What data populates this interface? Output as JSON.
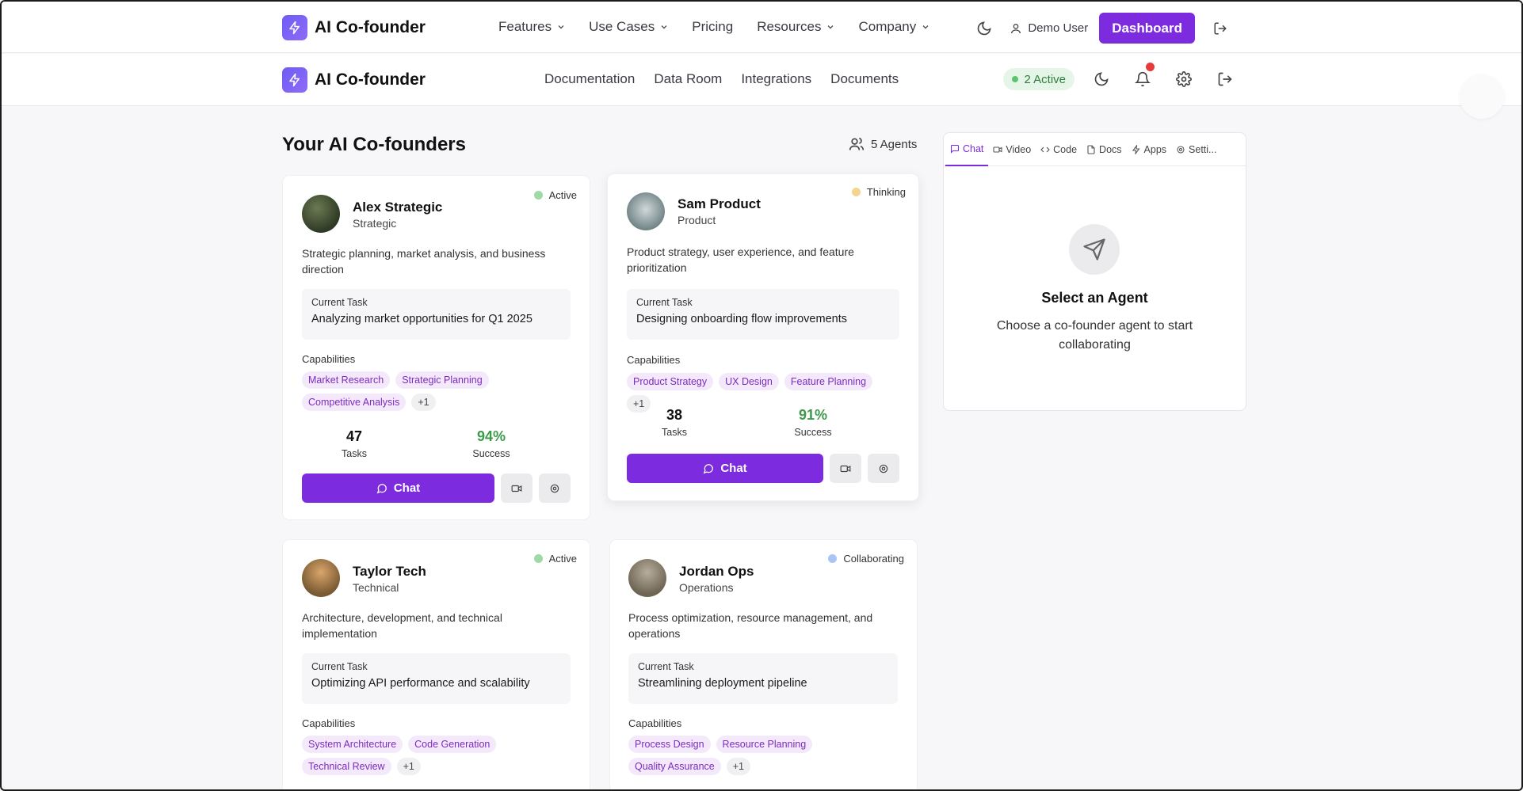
{
  "topnav": {
    "brand": "AI Co-founder",
    "menu": [
      {
        "label": "Features",
        "dropdown": true
      },
      {
        "label": "Use Cases",
        "dropdown": true
      },
      {
        "label": "Pricing",
        "dropdown": false
      },
      {
        "label": "Resources",
        "dropdown": true
      },
      {
        "label": "Company",
        "dropdown": true
      }
    ],
    "user": "Demo User",
    "dashboard": "Dashboard"
  },
  "subnav": {
    "brand": "AI Co-founder",
    "menu": [
      "Documentation",
      "Data Room",
      "Integrations",
      "Documents"
    ],
    "active_status": "2 Active"
  },
  "main": {
    "title": "Your AI Co-founders",
    "agents_count": "5 Agents",
    "task_label": "Current Task",
    "caps_label": "Capabilities",
    "tasks_label": "Tasks",
    "success_label": "Success",
    "chat_label": "Chat",
    "agents": [
      {
        "name": "Alex Strategic",
        "role": "Strategic",
        "status": "Active",
        "status_color": "#9ed9a6",
        "desc": "Strategic planning, market analysis, and business direction",
        "task": "Analyzing market opportunities for Q1 2025",
        "caps": [
          "Market Research",
          "Strategic Planning",
          "Competitive Analysis"
        ],
        "more": "+1",
        "tasks": "47",
        "success": "94%"
      },
      {
        "name": "Sam Product",
        "role": "Product",
        "status": "Thinking",
        "status_color": "#f3d58e",
        "desc": "Product strategy, user experience, and feature prioritization",
        "task": "Designing onboarding flow improvements",
        "caps": [
          "Product Strategy",
          "UX Design",
          "Feature Planning"
        ],
        "more": "+1",
        "tasks": "38",
        "success": "91%"
      },
      {
        "name": "Taylor Tech",
        "role": "Technical",
        "status": "Active",
        "status_color": "#9ed9a6",
        "desc": "Architecture, development, and technical implementation",
        "task": "Optimizing API performance and scalability",
        "caps": [
          "System Architecture",
          "Code Generation",
          "Technical Review"
        ],
        "more": "+1"
      },
      {
        "name": "Jordan Ops",
        "role": "Operations",
        "status": "Collaborating",
        "status_color": "#a9c4f5",
        "desc": "Process optimization, resource management, and operations",
        "task": "Streamlining deployment pipeline",
        "caps": [
          "Process Design",
          "Resource Planning",
          "Quality Assurance"
        ],
        "more": "+1"
      }
    ]
  },
  "panel": {
    "tabs": [
      {
        "label": "Chat",
        "icon": "message-icon"
      },
      {
        "label": "Video",
        "icon": "video-icon"
      },
      {
        "label": "Code",
        "icon": "code-icon"
      },
      {
        "label": "Docs",
        "icon": "file-icon"
      },
      {
        "label": "Apps",
        "icon": "bolt-icon"
      },
      {
        "label": "Setti...",
        "icon": "gear-icon"
      }
    ],
    "empty_title": "Select an Agent",
    "empty_sub": "Choose a co-founder agent to start collaborating"
  },
  "colors": {
    "accent": "#7c2bde",
    "success": "#3c9a4a",
    "notification": "#e63a3a"
  }
}
